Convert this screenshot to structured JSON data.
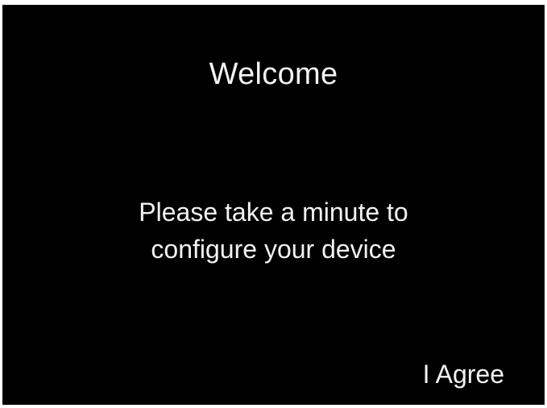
{
  "screen": {
    "title": "Welcome",
    "message_line_1": "Please take a minute to",
    "message_line_2": "configure your device",
    "agree_label": "I Agree"
  }
}
